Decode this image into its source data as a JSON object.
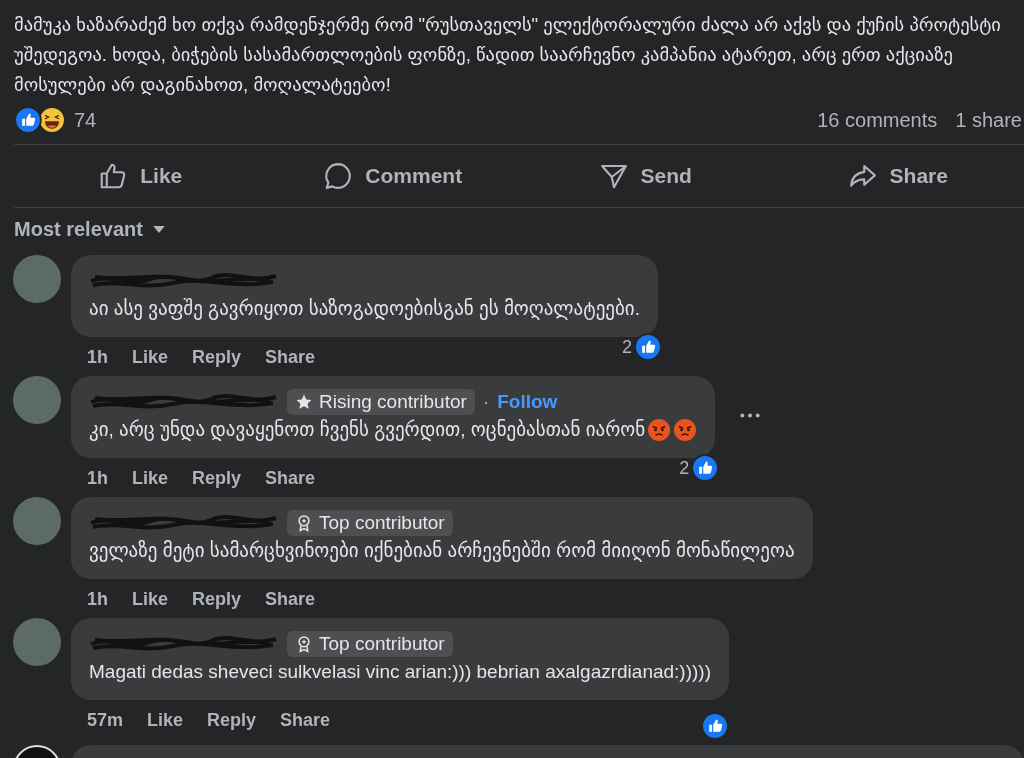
{
  "post": {
    "text": "მამუკა ხაზარაძემ ხო თქვა რამდენჯერმე რომ \"რუსთაველს\" ელექტორალური ძალა არ აქვს და ქუჩის პროტესტი უშედეგოა. ხოდა, ბიჭების სასამართლოების ფონზე, წადით საარჩევნო კამპანია ატარეთ, არც ერთ აქციაზე მოსულები არ დაგინახოთ, მოღალატეებო!",
    "reactions": [
      {
        "kind": "like"
      },
      {
        "kind": "haha"
      }
    ],
    "reaction_count": "74",
    "comments_count": "16 comments",
    "shares_count": "1 share"
  },
  "actions": [
    {
      "kind": "like",
      "label": "Like"
    },
    {
      "kind": "comment",
      "label": "Comment"
    },
    {
      "kind": "send",
      "label": "Send"
    },
    {
      "kind": "share",
      "label": "Share"
    }
  ],
  "sort": {
    "label": "Most relevant"
  },
  "comments": [
    {
      "text": "აი ასე ვაფშე გავრიყოთ საზოგადოებისგან ეს მოღალატეები.",
      "time": "1h",
      "links": [
        "Like",
        "Reply",
        "Share"
      ],
      "reactions": [
        {
          "kind": "like"
        }
      ],
      "like_count": "2",
      "more": false
    },
    {
      "badge": {
        "kind": "star",
        "label": "Rising contributor"
      },
      "separator": "·",
      "follow": "Follow",
      "text": "კი, არც უნდა დავაყენოთ ჩვენს გვერდით, ოცნებასთან იარონ",
      "emojis": [
        {
          "kind": "angry"
        },
        {
          "kind": "angry"
        }
      ],
      "time": "1h",
      "links": [
        "Like",
        "Reply",
        "Share"
      ],
      "reactions": [
        {
          "kind": "like"
        }
      ],
      "like_count": "2",
      "more": true
    },
    {
      "badge": {
        "kind": "award",
        "label": "Top contributor"
      },
      "text": "ველაზე მეტი სამარცხვინოები იქნებიან არჩევნებში რომ მიიღონ მონაწილეოა",
      "time": "1h",
      "links": [
        "Like",
        "Reply",
        "Share"
      ],
      "more": false
    },
    {
      "badge": {
        "kind": "award",
        "label": "Top contributor"
      },
      "text": "Magati dedas sheveci sulkvelasi vinc arian:))) bebrian axalgazrdianad:)))))",
      "time": "57m",
      "links": [
        "Like",
        "Reply",
        "Share"
      ],
      "reactions": [
        {
          "kind": "like"
        }
      ],
      "more": false
    }
  ]
}
